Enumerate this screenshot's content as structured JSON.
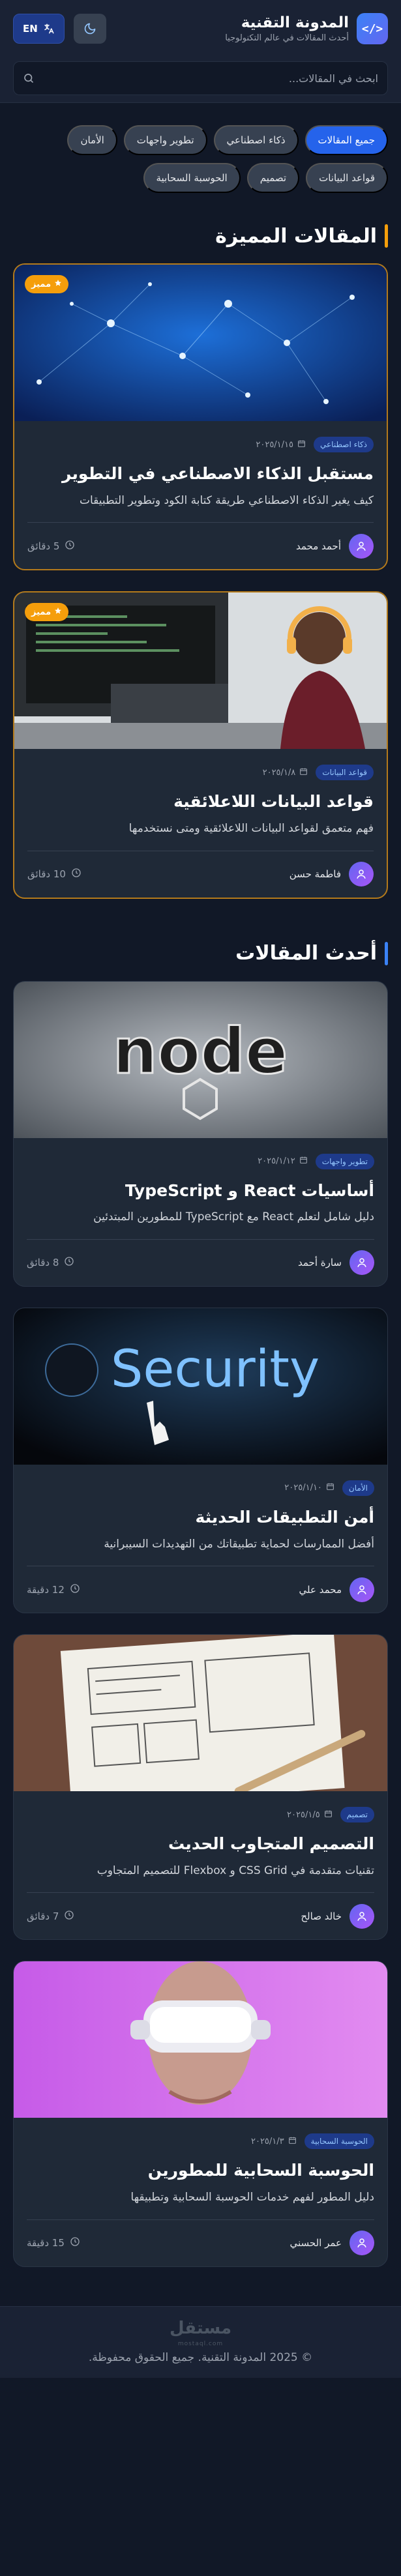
{
  "header": {
    "title": "المدونة التقنية",
    "subtitle": "أحدث المقالات في عالم التكنولوجيا",
    "lang_label": "EN",
    "search_placeholder": "ابحث في المقالات..."
  },
  "categories": [
    {
      "label": "جميع المقالات",
      "active": true
    },
    {
      "label": "ذكاء اصطناعي",
      "active": false
    },
    {
      "label": "تطوير واجهات",
      "active": false
    },
    {
      "label": "الأمان",
      "active": false
    },
    {
      "label": "قواعد البيانات",
      "active": false
    },
    {
      "label": "تصميم",
      "active": false
    },
    {
      "label": "الحوسبة السحابية",
      "active": false
    }
  ],
  "featured_section": {
    "title": "المقالات المميزة",
    "badge_label": "مميز",
    "articles": [
      {
        "category": "ذكاء اصطناعي",
        "date": "٢٠٢٥/١/١٥",
        "title": "مستقبل الذكاء الاصطناعي في التطوير",
        "description": "كيف يغير الذكاء الاصطناعي طريقة كتابة الكود وتطوير التطبيقات",
        "author": "أحمد محمد",
        "read_time": "5 دقائق",
        "image": "ai-network"
      },
      {
        "category": "قواعد البيانات",
        "date": "٢٠٢٥/١/٨",
        "title": "قواعد البيانات اللاعلائقية",
        "description": "فهم متعمق لقواعد البيانات اللاعلائقية ومتى نستخدمها",
        "author": "فاطمة حسن",
        "read_time": "10 دقائق",
        "image": "developer-desk"
      }
    ]
  },
  "latest_section": {
    "title": "أحدث المقالات",
    "articles": [
      {
        "category": "تطوير واجهات",
        "date": "٢٠٢٥/١/١٢",
        "title": "أساسيات React و TypeScript",
        "description": "دليل شامل لتعلم React مع TypeScript للمطورين المبتدئين",
        "author": "سارة أحمد",
        "read_time": "8 دقائق",
        "image": "nodejs-logo",
        "image_text": "node"
      },
      {
        "category": "الأمان",
        "date": "٢٠٢٥/١/١٠",
        "title": "أمن التطبيقات الحديثة",
        "description": "أفضل الممارسات لحماية تطبيقاتك من التهديدات السيبرانية",
        "author": "محمد علي",
        "read_time": "12 دقيقة",
        "image": "security-screen",
        "image_text": "Security"
      },
      {
        "category": "تصميم",
        "date": "٢٠٢٥/١/٥",
        "title": "التصميم المتجاوب الحديث",
        "description": "تقنيات متقدمة في CSS Grid و Flexbox للتصميم المتجاوب",
        "author": "خالد صالح",
        "read_time": "7 دقائق",
        "image": "wireframe-sketch"
      },
      {
        "category": "الحوسبة السحابية",
        "date": "٢٠٢٥/١/٣",
        "title": "الحوسبة السحابية للمطورين",
        "description": "دليل المطور لفهم خدمات الحوسبة السحابية وتطبيقها",
        "author": "عمر الحسني",
        "read_time": "15 دقيقة",
        "image": "vr-headset"
      }
    ]
  },
  "footer": {
    "watermark": "مستقل",
    "watermark_sub": "mostaql.com",
    "copyright": "© 2025 المدونة التقنية. جميع الحقوق محفوظة."
  },
  "colors": {
    "accent": "#2563eb",
    "featured": "#f59e0b",
    "background": "#111827",
    "card": "#1f2937"
  }
}
